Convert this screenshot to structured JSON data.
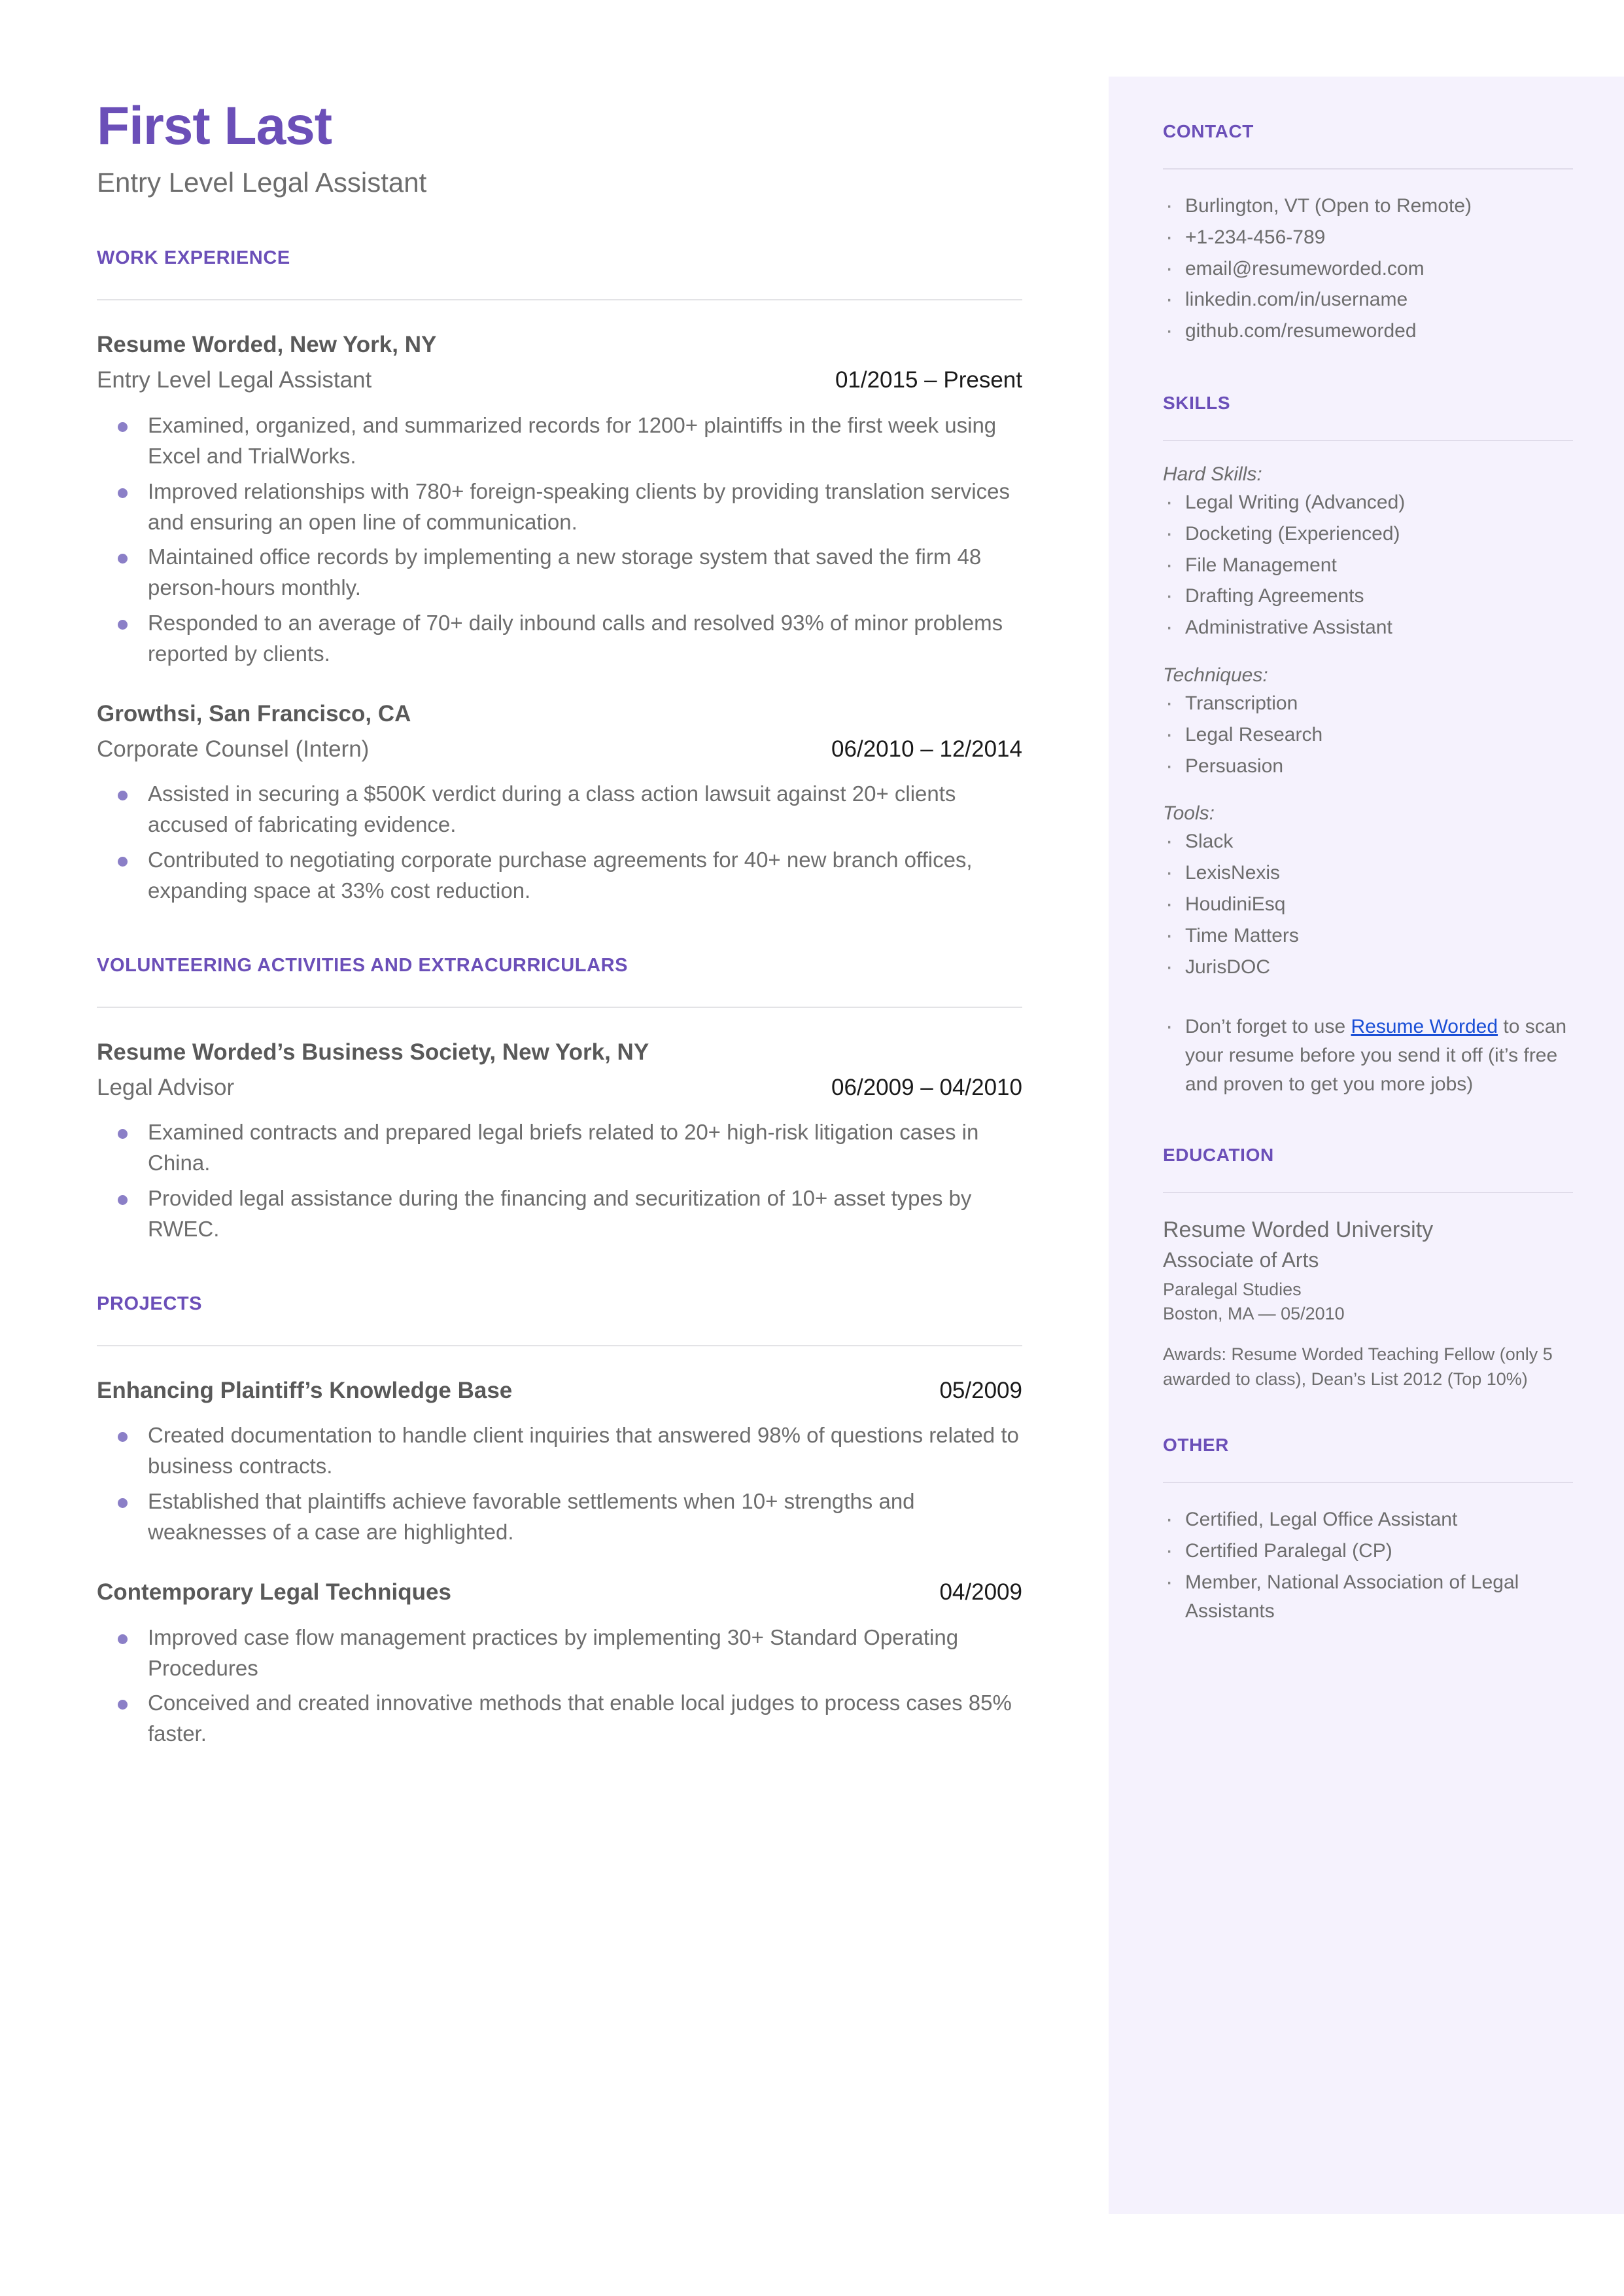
{
  "theme": {
    "accent_purple": "#6b4fb8",
    "bullet_purple": "#8b7fc7",
    "sidebar_bg": "#f5f2fd",
    "body_gray": "#6d6d6d",
    "link_blue": "#1a4fd6"
  },
  "header": {
    "name": "First Last",
    "subtitle": "Entry Level Legal Assistant"
  },
  "sections": {
    "work_experience": {
      "heading": "WORK EXPERIENCE",
      "entries": [
        {
          "organization": "Resume Worded, New York, NY",
          "role": "Entry Level Legal Assistant",
          "date": "01/2015 – Present",
          "bullets": [
            "Examined, organized, and summarized records for 1200+ plaintiffs in the first week using Excel and TrialWorks.",
            "Improved relationships with 780+ foreign-speaking clients by providing translation services and ensuring an open line of communication.",
            "Maintained office records by implementing a new storage system that saved the firm 48 person-hours monthly.",
            "Responded to an average of 70+ daily inbound calls and resolved 93% of minor problems reported by clients."
          ]
        },
        {
          "organization": "Growthsi, San Francisco, CA",
          "role": "Corporate Counsel (Intern)",
          "date": "06/2010 – 12/2014",
          "bullets": [
            "Assisted in securing a $500K verdict during a class action lawsuit against 20+ clients accused of fabricating evidence.",
            "Contributed to negotiating corporate purchase agreements for 40+ new branch offices, expanding space at 33% cost reduction."
          ]
        }
      ]
    },
    "volunteering": {
      "heading": "VOLUNTEERING ACTIVITIES AND EXTRACURRICULARS",
      "entries": [
        {
          "organization": "Resume Worded’s Business Society, New York, NY",
          "role": "Legal Advisor",
          "date": "06/2009 – 04/2010",
          "bullets": [
            "Examined contracts and prepared legal briefs related to 20+ high-risk litigation cases in China.",
            "Provided legal assistance during the financing and securitization of 10+ asset types by RWEC."
          ]
        }
      ]
    },
    "projects": {
      "heading": "PROJECTS",
      "entries": [
        {
          "title": "Enhancing Plaintiff’s Knowledge Base",
          "date": "05/2009",
          "bullets": [
            "Created documentation to handle client inquiries that answered 98% of questions related to business contracts.",
            "Established that plaintiffs achieve favorable settlements when 10+ strengths and weaknesses of a case are highlighted."
          ]
        },
        {
          "title": "Contemporary Legal Techniques",
          "date": "04/2009",
          "bullets": [
            "Improved case flow management practices by implementing 30+ Standard Operating Procedures",
            "Conceived and created innovative methods that enable local judges to process cases 85% faster."
          ]
        }
      ]
    }
  },
  "sidebar": {
    "contact": {
      "heading": "CONTACT",
      "items": [
        "Burlington, VT (Open to Remote)",
        "+1-234-456-789",
        "email@resumeworded.com",
        "linkedin.com/in/username",
        "github.com/resumeworded"
      ]
    },
    "skills": {
      "heading": "SKILLS",
      "groups": [
        {
          "label": "Hard Skills:",
          "items": [
            "Legal Writing (Advanced)",
            "Docketing (Experienced)",
            "File Management",
            "Drafting Agreements",
            "Administrative Assistant"
          ]
        },
        {
          "label": "Techniques:",
          "items": [
            "Transcription",
            "Legal Research",
            "Persuasion"
          ]
        },
        {
          "label": "Tools:",
          "items": [
            "Slack",
            "LexisNexis",
            "HoudiniEsq",
            "Time Matters",
            "JurisDOC"
          ]
        }
      ],
      "note": {
        "prefix": "Don’t forget to use ",
        "link_text": "Resume Worded",
        "suffix": " to scan your resume before you send it off (it’s free and proven to get you more jobs)"
      }
    },
    "education": {
      "heading": "EDUCATION",
      "school": "Resume Worded University",
      "degree": "Associate of Arts",
      "field": "Paralegal Studies",
      "location_date": "Boston, MA — 05/2010",
      "awards": "Awards: Resume Worded Teaching Fellow (only 5 awarded to class), Dean’s List 2012 (Top 10%)"
    },
    "other": {
      "heading": "OTHER",
      "items": [
        "Certified, Legal Office Assistant",
        "Certified Paralegal (CP)",
        "Member, National Association of Legal Assistants"
      ]
    }
  }
}
